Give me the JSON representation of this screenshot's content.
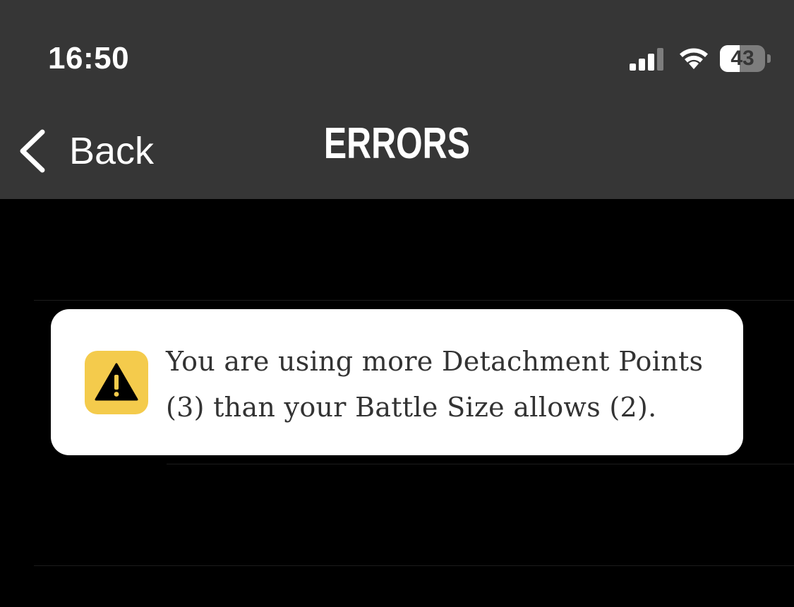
{
  "status_bar": {
    "time": "16:50",
    "battery_level": "43",
    "battery_fraction": 0.43,
    "signal_bars": 3,
    "signal_bars_max": 4,
    "icons": [
      "cellular-signal-icon",
      "wifi-icon",
      "battery-icon"
    ]
  },
  "nav_bar": {
    "back_label": "Back",
    "title": "ERRORS"
  },
  "errors": [
    {
      "icon": "warning-icon",
      "message": "You are using more Detachment Points (3) than your Battle Size allows (2)."
    }
  ],
  "colors": {
    "header_bg": "#363636",
    "page_bg": "#000000",
    "card_bg": "#ffffff",
    "warning_yellow": "#f4cb4c",
    "text_dark": "#333333"
  }
}
